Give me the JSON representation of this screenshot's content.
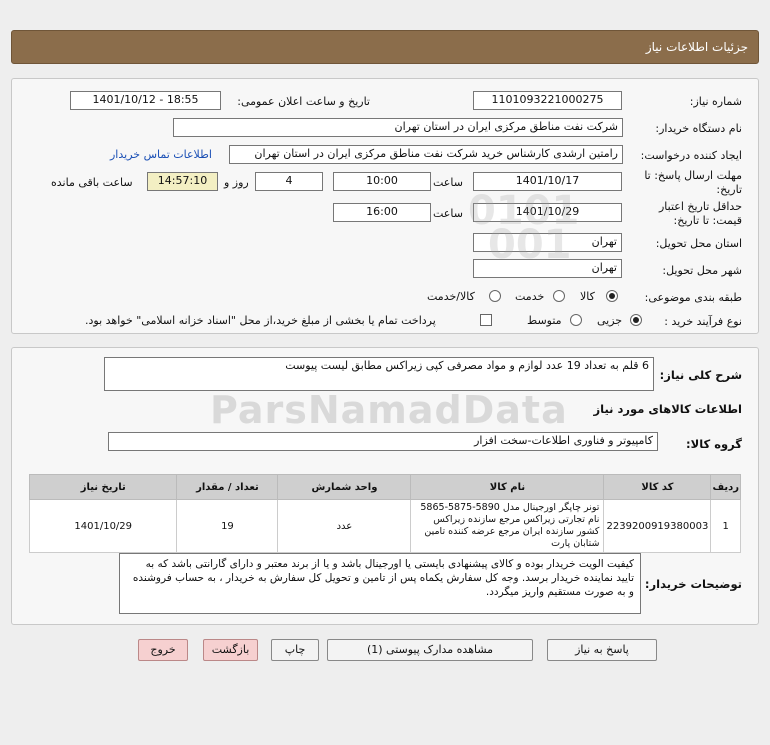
{
  "header": {
    "title": "جزئیات اطلاعات نیاز"
  },
  "form": {
    "need_number_label": "شماره نیاز:",
    "need_number": "1101093221000275",
    "announce_label": "تاریخ و ساعت اعلان عمومی:",
    "announce_value": "1401/10/12 - 18:55",
    "buyer_org_label": "نام دستگاه خریدار:",
    "buyer_org": "شرکت نفت مناطق مرکزی ایران در استان تهران",
    "creator_label": "ایجاد کننده درخواست:",
    "creator": "رامتین ارشدی کارشناس خرید شرکت نفت مناطق مرکزی ایران در استان تهران",
    "contact_link": "اطلاعات تماس خریدار",
    "deadline_label_1": "مهلت ارسال پاسخ: تا",
    "deadline_label_2": "تاریخ:",
    "deadline_date": "1401/10/17",
    "time_label": "ساعت",
    "deadline_time": "10:00",
    "days_value": "4",
    "days_label": "روز و",
    "remaining_time": "14:57:10",
    "remaining_label": "ساعت باقی مانده",
    "validity_label_1": "حداقل تاریخ اعتبار",
    "validity_label_2": "قیمت: تا تاریخ:",
    "validity_date": "1401/10/29",
    "validity_time": "16:00",
    "delivery_province_label": "استان محل تحویل:",
    "delivery_province": "تهران",
    "delivery_city_label": "شهر محل تحویل:",
    "delivery_city": "تهران",
    "category_label": "طبقه بندی موضوعی:",
    "category_options": [
      "کالا",
      "خدمت",
      "کالا/خدمت"
    ],
    "process_label": "نوع فرآیند خرید :",
    "process_options": [
      "جزیی",
      "متوسط"
    ],
    "payment_note": "پرداخت تمام یا بخشی از مبلغ خرید،از محل \"اسناد خزانه اسلامی\" خواهد بود."
  },
  "details": {
    "summary_label": "شرح کلی نیاز:",
    "summary": "6 قلم به تعداد 19 عدد لوازم و مواد مصرفی کپی زیراکس مطابق لیست پیوست",
    "goods_info_title": "اطلاعات کالاهای مورد نیاز",
    "goods_group_label": "گروه کالا:",
    "goods_group": "کامپیوتر و فناوری اطلاعات-سخت افزار",
    "table_headers": [
      "ردیف",
      "کد کالا",
      "نام کالا",
      "واحد شمارش",
      "تعداد / مقدار",
      "تاریخ نیاز"
    ],
    "rows": [
      {
        "row": "1",
        "code": "2239200919380003",
        "name": "تونر چاپگر اورجینال مدل 5890-5875-5865 نام تجارتی زیراکس مرجع سازنده زیراکس کشور سازنده ایران مرجع عرضه کننده تامین شتابان پارت",
        "unit": "عدد",
        "qty": "19",
        "date": "1401/10/29"
      }
    ],
    "buyer_notes_label": "توضیحات خریدار:",
    "buyer_notes": "کیفیت الویت خریدار بوده و کالای پیشنهادی بایستی یا اورجینال باشد و یا از برند معتبر و دارای گارانتی باشد که به تایید نماینده خریدار برسد. وجه کل سفارش یکماه پس از تامین و تحویل کل سفارش به خریدار ، به حساب فروشنده و به صورت مستقیم واریز میگردد."
  },
  "watermark": {
    "text": "ParsNamadData"
  },
  "buttons": {
    "reply": "پاسخ به نیاز",
    "view_docs": "مشاهده مدارک پیوستی (1)",
    "print": "چاپ",
    "back": "بازگشت",
    "exit": "خروج"
  }
}
